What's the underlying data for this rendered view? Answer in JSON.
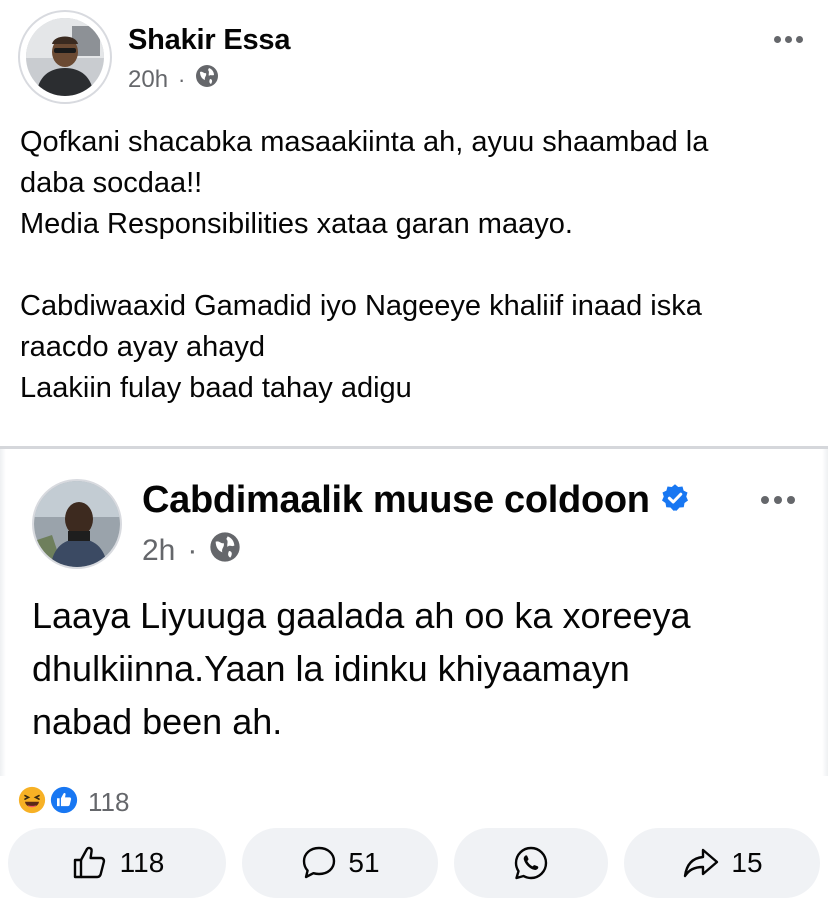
{
  "post": {
    "author": "Shakir Essa",
    "time": "20h",
    "separator": "·",
    "audience_icon": "globe-icon",
    "text_lines": [
      "Qofkani shacabka masaakiinta ah, ayuu shaambad la",
      "daba socdaa!!",
      "Media Responsibilities xataa garan maayo.",
      "",
      "Cabdiwaaxid Gamadid iyo Nageeye khaliif inaad iska",
      "raacdo ayay ahayd",
      "Laakiin fulay baad tahay adigu"
    ]
  },
  "shared": {
    "author": "Cabdimaalik muuse coldoon",
    "verified_icon": "verified-badge-icon",
    "time": "2h",
    "separator": "·",
    "audience_icon": "globe-icon",
    "text_lines": [
      "Laaya Liyuuga gaalada ah oo ka xoreeya",
      "dhulkiinna.Yaan la idinku khiyaamayn",
      "nabad been ah."
    ]
  },
  "reactions": {
    "icons": [
      "haha-icon",
      "like-icon"
    ],
    "count": "118"
  },
  "actions": {
    "like_count": "118",
    "comment_count": "51",
    "share_count": "15"
  },
  "colors": {
    "brand_blue": "#1877f2",
    "haha_yellow": "#f7b125",
    "secondary_text": "#65676b",
    "button_bg": "#f0f2f5"
  }
}
